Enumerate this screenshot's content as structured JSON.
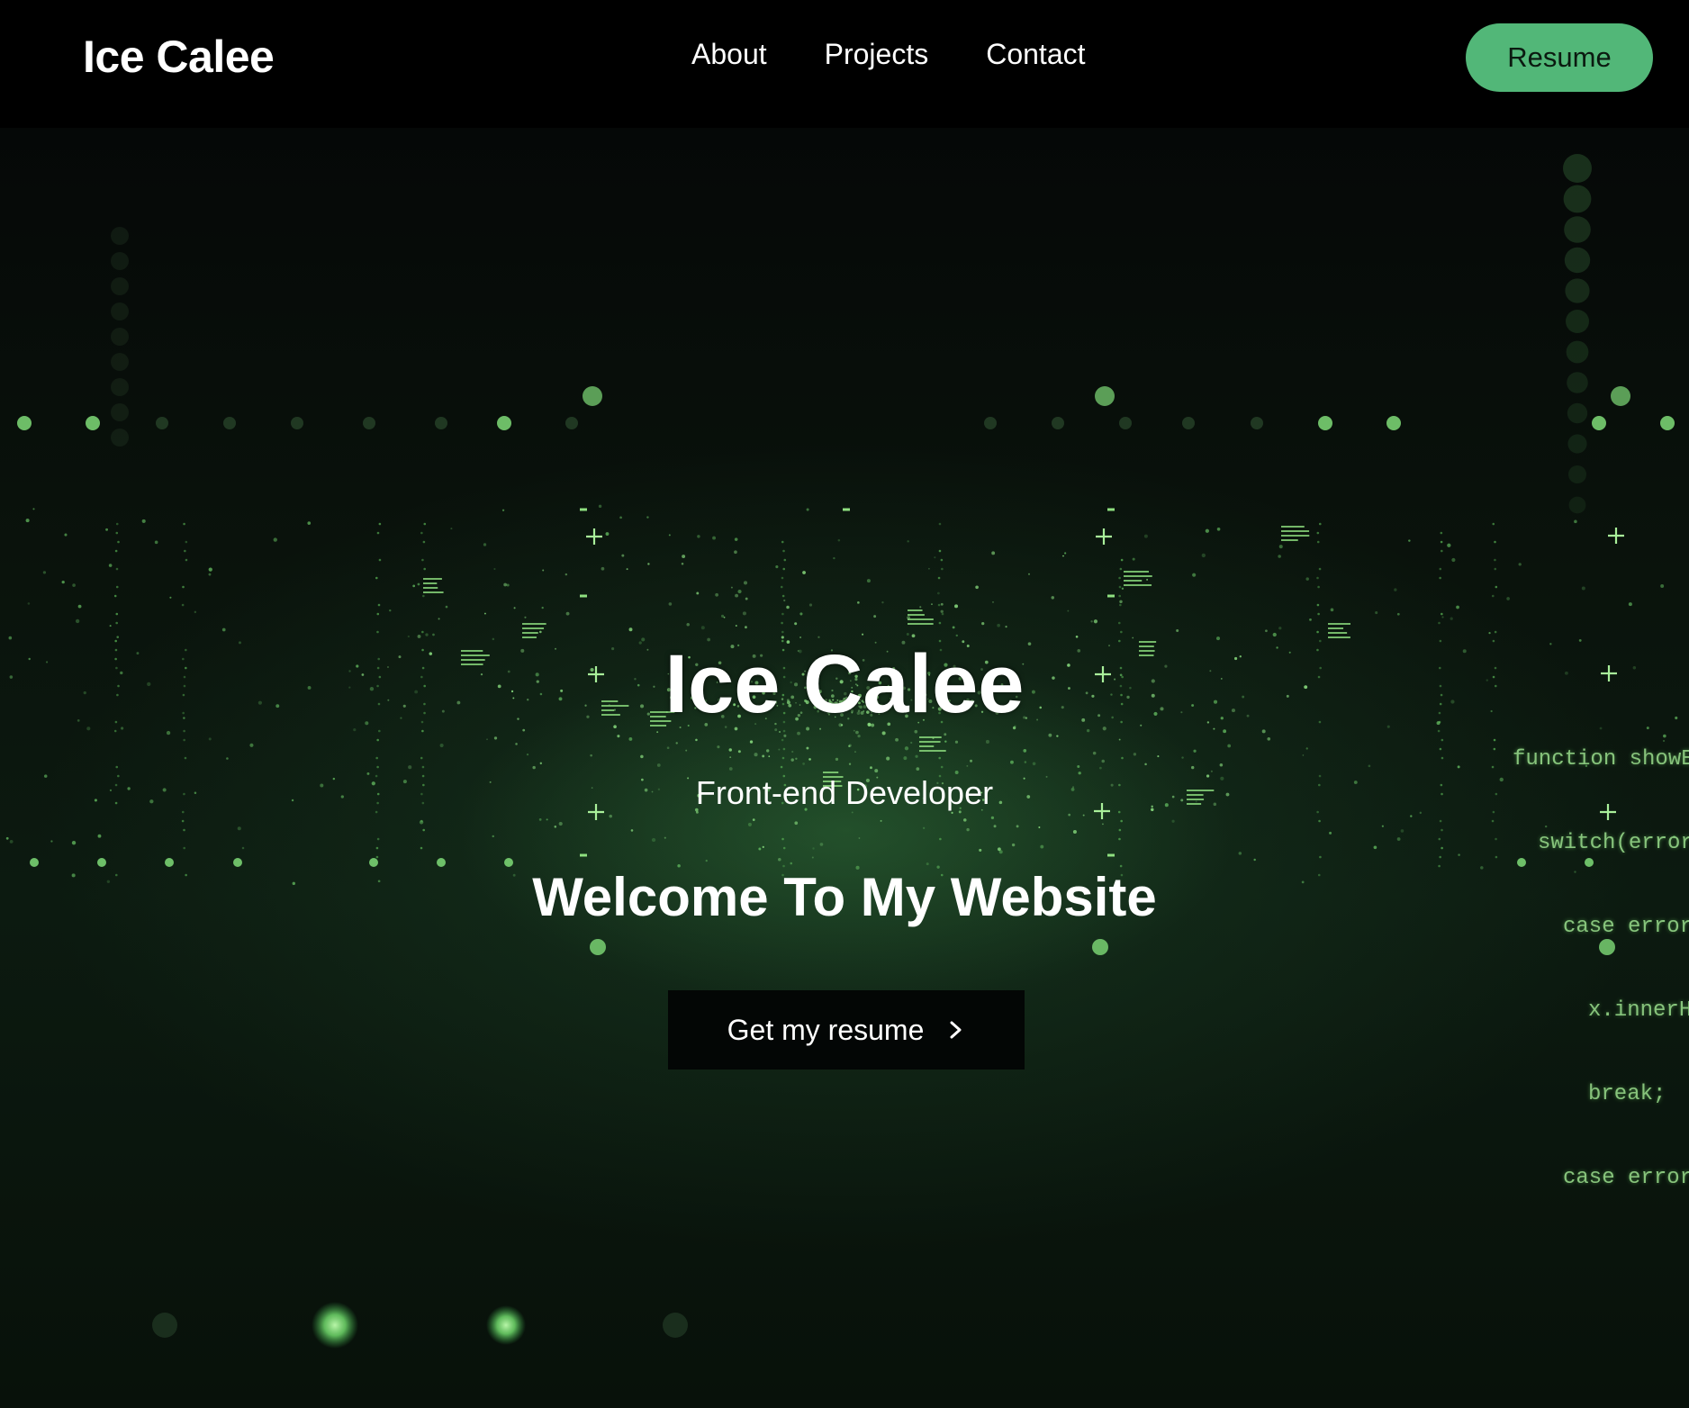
{
  "nav": {
    "brand": "Ice Calee",
    "links": [
      "About",
      "Projects",
      "Contact"
    ],
    "resume_button": "Resume"
  },
  "hero": {
    "title": "Ice Calee",
    "subtitle": "Front-end Developer",
    "welcome": "Welcome To My Website",
    "cta_label": "Get my resume",
    "cta_icon": "chevron-right-icon",
    "background_code": [
      "function showErr",
      "switch(error.co",
      "case error.P",
      "x.innerHT",
      "break;",
      "case error.P"
    ]
  },
  "colors": {
    "accent": "#52b778",
    "glow": "#7fe07a",
    "background": "#000000"
  }
}
